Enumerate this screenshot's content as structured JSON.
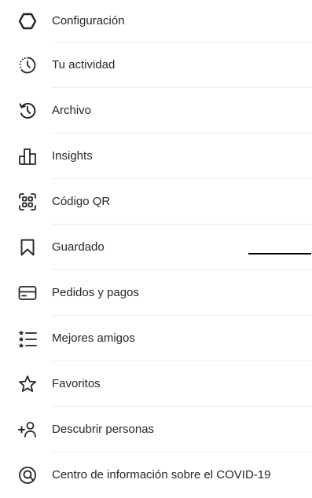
{
  "menu": {
    "items": [
      {
        "label": "Configuración",
        "icon": "gear-icon"
      },
      {
        "label": "Tu actividad",
        "icon": "activity-icon"
      },
      {
        "label": "Archivo",
        "icon": "archive-icon"
      },
      {
        "label": "Insights",
        "icon": "insights-icon"
      },
      {
        "label": "Código QR",
        "icon": "qr-code-icon"
      },
      {
        "label": "Guardado",
        "icon": "bookmark-icon"
      },
      {
        "label": "Pedidos y pagos",
        "icon": "credit-card-icon"
      },
      {
        "label": "Mejores amigos",
        "icon": "close-friends-list-icon"
      },
      {
        "label": "Favoritos",
        "icon": "star-icon"
      },
      {
        "label": "Descubrir personas",
        "icon": "add-person-icon"
      },
      {
        "label": "Centro de información sobre el COVID-19",
        "icon": "covid-info-icon"
      }
    ]
  },
  "colors": {
    "text": "#262626",
    "divider": "#efefef",
    "background": "#ffffff"
  }
}
